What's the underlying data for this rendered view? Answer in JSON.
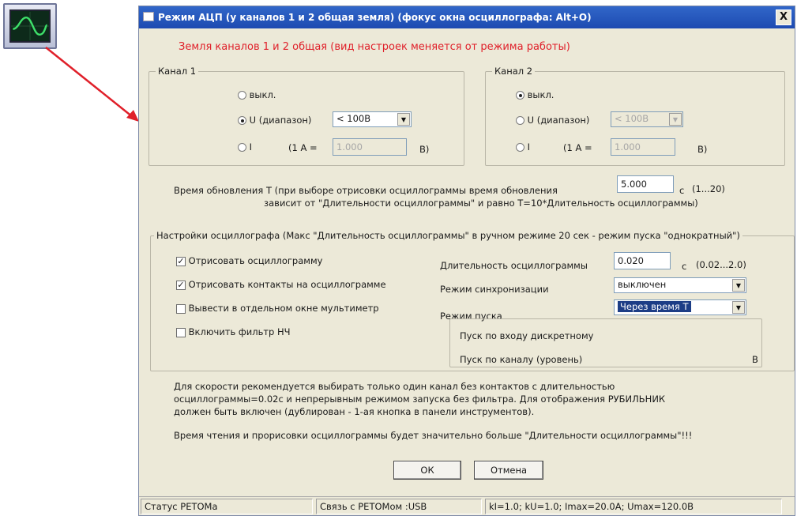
{
  "window": {
    "title": "Режим АЦП (у каналов 1 и 2 общая земля) (фокус окна осциллографа: Alt+O)",
    "close_glyph": "X"
  },
  "warning": "Земля каналов 1 и 2 общая (вид настроек меняется от режима работы)",
  "channel1": {
    "legend": "Канал 1",
    "off_label": "выкл.",
    "u_label": "U (диапазон)",
    "u_range": "< 100В",
    "i_label": "I",
    "i_ratio_prefix": "(1 А =",
    "i_ratio_value": "1.000",
    "i_ratio_suffix": "В)",
    "selected": "u"
  },
  "channel2": {
    "legend": "Канал 2",
    "off_label": "выкл.",
    "u_label": "U (диапазон)",
    "u_range": "< 100В",
    "i_label": "I",
    "i_ratio_prefix": "(1 А =",
    "i_ratio_value": "1.000",
    "i_ratio_suffix": "В)",
    "selected": "off"
  },
  "update": {
    "label_line1": "Время обновления Т (при выборе отрисовки осциллограммы время обновления",
    "label_line2": "зависит от \"Длительности осциллограммы\" и равно Т=10*Длительность осциллограммы)",
    "value": "5.000",
    "unit": "с",
    "range": "(1...20)"
  },
  "scope": {
    "legend": "Настройки осциллографа (Макс \"Длительность осциллограммы\" в ручном режиме 20 сек - режим пуска \"однократный\")",
    "checks": [
      {
        "label": "Отрисовать осциллограмму",
        "checked": true
      },
      {
        "label": "Отрисовать контакты на осциллограмме",
        "checked": true
      },
      {
        "label": "Вывести в отдельном окне мультиметр",
        "checked": false
      },
      {
        "label": "Включить фильтр НЧ",
        "checked": false
      }
    ],
    "duration_label": "Длительность осциллограммы",
    "duration_value": "0.020",
    "duration_unit": "с",
    "duration_range": "(0.02...2.0)",
    "sync_label": "Режим синхронизации",
    "sync_value": "выключен",
    "start_label": "Режим пуска",
    "start_value": "Через время Т",
    "trigger_discrete": "Пуск по входу дискретному",
    "trigger_channel": "Пуск по каналу (уровень)",
    "trigger_unit": "В"
  },
  "notes": {
    "line1": "Для скорости рекомендуется выбирать только один канал без контактов с длительностью",
    "line2": "осциллограммы=0.02с и непрерывным режимом запуска без фильтра. Для отображения РУБИЛЬНИК",
    "line3": "должен быть включен (дублирован - 1-ая кнопка в панели инструментов).",
    "line4": "Время чтения и прорисовки осциллограммы будет значительно больше \"Длительности осциллограммы\"!!!"
  },
  "buttons": {
    "ok": "ОК",
    "cancel": "Отмена"
  },
  "status": {
    "device": "Статус РЕТОМа",
    "link": "Связь с РЕТОМом :USB",
    "params": "kI=1.0; kU=1.0; Imax=20.0A; Umax=120.0В"
  },
  "colors": {
    "title_bar": "#1d4ab1",
    "warning_text": "#e0202a",
    "arrow": "#e0202a",
    "selection": "#1c3d86"
  }
}
